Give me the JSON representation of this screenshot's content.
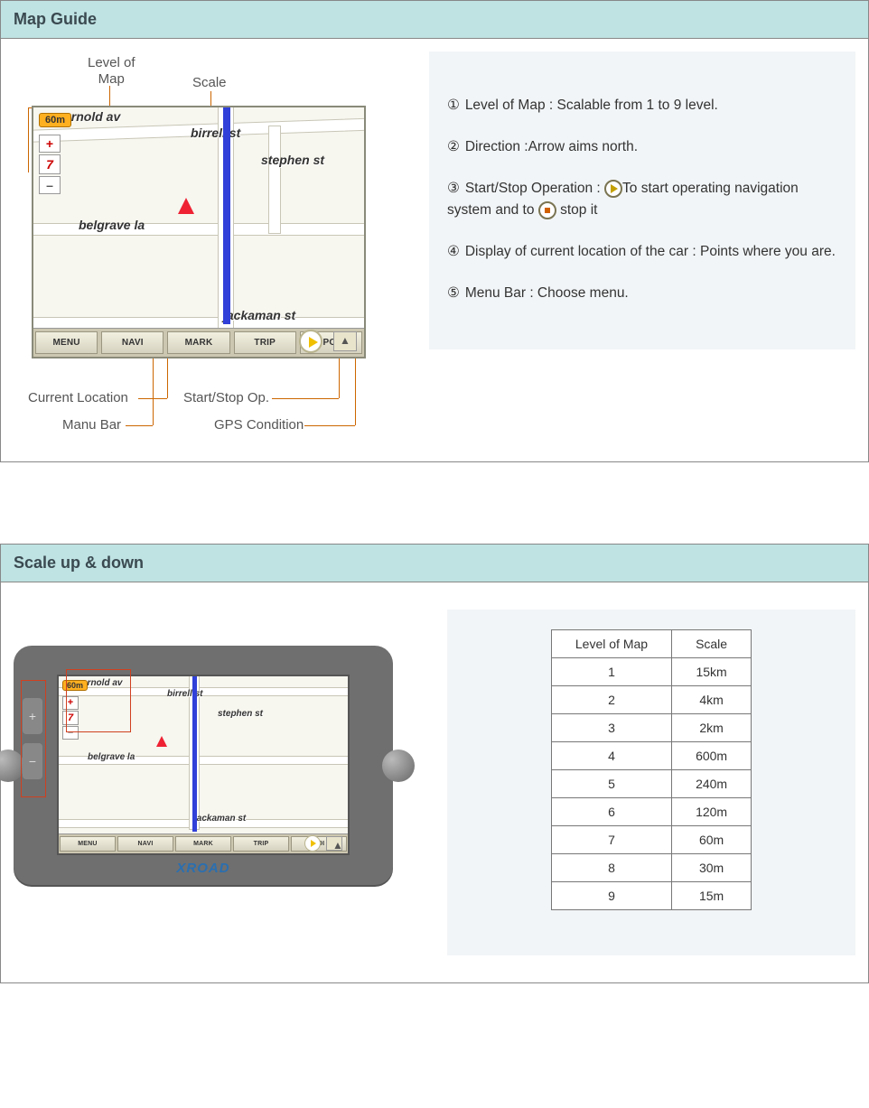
{
  "sections": {
    "map_guide": {
      "title": "Map Guide"
    },
    "scale": {
      "title": "Scale up & down"
    }
  },
  "callouts": {
    "level_of_map_l1": "Level of",
    "level_of_map_l2": "Map",
    "scale": "Scale",
    "current_location": "Current Location",
    "start_stop_op": "Start/Stop Op.",
    "manu_bar": "Manu Bar",
    "gps_condition": "GPS Condition"
  },
  "map": {
    "scale_badge": "60m",
    "zoom_level": "7",
    "zoom_plus": "+",
    "zoom_minus": "–",
    "streets": {
      "av": "arnold av",
      "birrell": "birrell st",
      "stephen": "stephen st",
      "belgrave": "belgrave la",
      "jackaman": "jackaman st"
    },
    "menu_items": [
      "MENU",
      "NAVI",
      "MARK",
      "TRIP",
      "POI"
    ]
  },
  "explanations": [
    {
      "num": "①",
      "text": "Level of Map : Scalable from 1 to 9 level."
    },
    {
      "num": "②",
      "text": "Direction :Arrow aims north."
    },
    {
      "num": "③",
      "prefix": "Start/Stop Operation :",
      "mid": "To start operating navigation system and to",
      "suffix": "stop it"
    },
    {
      "num": "④",
      "text": "Display of current location of the car : Points where you are."
    },
    {
      "num": "⑤",
      "text": "Menu Bar : Choose menu."
    }
  ],
  "device_logo": "XROAD",
  "scale_table": {
    "headers": {
      "level": "Level of Map",
      "scale": "Scale"
    },
    "rows": [
      {
        "level": "1",
        "scale": "15km"
      },
      {
        "level": "2",
        "scale": "4km"
      },
      {
        "level": "3",
        "scale": "2km"
      },
      {
        "level": "4",
        "scale": "600m"
      },
      {
        "level": "5",
        "scale": "240m"
      },
      {
        "level": "6",
        "scale": "120m"
      },
      {
        "level": "7",
        "scale": "60m"
      },
      {
        "level": "8",
        "scale": "30m"
      },
      {
        "level": "9",
        "scale": "15m"
      }
    ]
  }
}
